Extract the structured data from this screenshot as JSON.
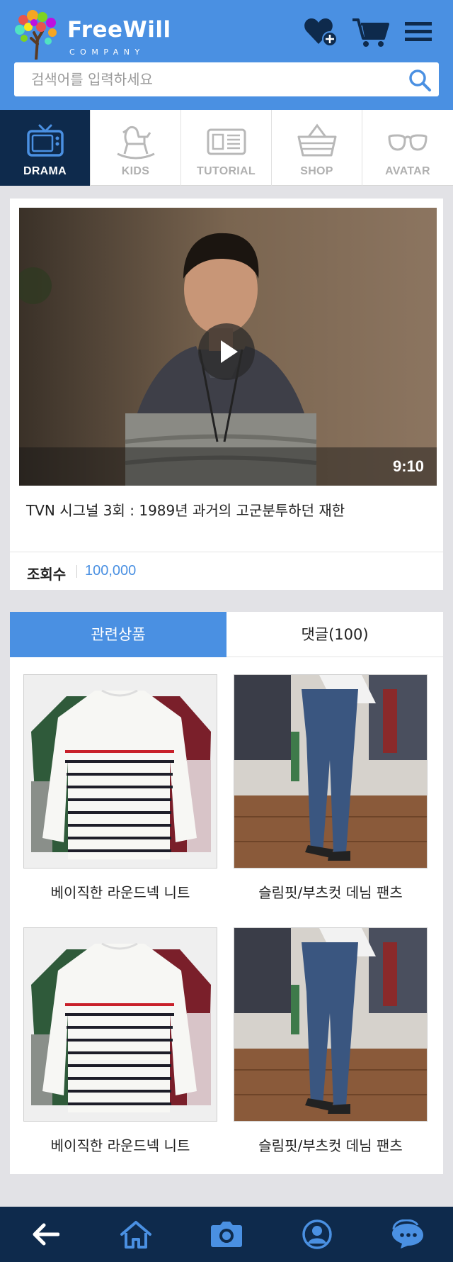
{
  "header": {
    "brand": "FreeWill",
    "brand_sub": "COMPANY",
    "icons": [
      "favorite-add-icon",
      "cart-icon",
      "menu-icon"
    ],
    "accent_color": "#4a90e2"
  },
  "search": {
    "placeholder": "검색어를 입력하세요",
    "value": ""
  },
  "categories": [
    {
      "label": "DRAMA",
      "icon": "tv-icon",
      "active": true
    },
    {
      "label": "KIDS",
      "icon": "rocking-horse-icon",
      "active": false
    },
    {
      "label": "TUTORIAL",
      "icon": "newspaper-icon",
      "active": false
    },
    {
      "label": "SHOP",
      "icon": "basket-icon",
      "active": false
    },
    {
      "label": "AVATAR",
      "icon": "glasses-icon",
      "active": false
    }
  ],
  "video": {
    "duration": "9:10",
    "title": "TVN 시그널 3회 : 1989년 과거의 고군분투하던 재한",
    "views_label": "조회수",
    "views_count": "100,000"
  },
  "tabs": {
    "related": "관련상품",
    "comments": "댓글(100)"
  },
  "products": [
    {
      "name": "베이직한 라운드넥 니트"
    },
    {
      "name": "슬림핏/부츠컷 데님 팬츠"
    },
    {
      "name": "베이직한 라운드넥 니트"
    },
    {
      "name": "슬림핏/부츠컷 데님 팬츠"
    }
  ],
  "bottom_nav": [
    "back-arrow-icon",
    "home-icon",
    "camera-icon",
    "profile-icon",
    "chat-icon"
  ],
  "colors": {
    "nav_dark": "#0e2a4c",
    "accent": "#4a90e2"
  }
}
